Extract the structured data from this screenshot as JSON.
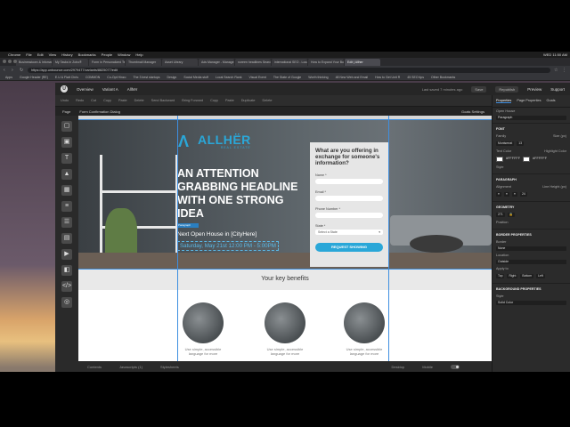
{
  "menubar": {
    "apple": "",
    "items": [
      "Chrome",
      "File",
      "Edit",
      "View",
      "History",
      "Bookmarks",
      "People",
      "Window",
      "Help"
    ],
    "right_status": "WED 11:50 AM"
  },
  "browser": {
    "tabs": [
      "Businesstown & Infomation",
      "My Tasks in Zoho®",
      "Form in Personalized Template",
      "Thumbnail Manager",
      "Asset Library",
      "Ads Manager - Manage",
      "noreen headlines Search",
      "international SEO - Localized",
      "How to Expand Your Business",
      "Edit | Allher"
    ],
    "active_tab_index": 9,
    "url": "https://app.unbounce.com/2979477/variants/8825077/edit",
    "bookmarks": [
      "Apps",
      "Google Header (RE)",
      "E.U & Flatt Chris",
      "COMMON",
      "Co-Opt Hinzo",
      "The 3 best startups",
      "Design",
      "Social Media stuff",
      "Local Search Rank",
      "Visual Event",
      "The State of Google",
      "Worth thinking",
      "48 New Web and Email",
      "How to Get Unit R",
      "45 SEO tips",
      "Other Bookmarks"
    ]
  },
  "app_header": {
    "overview": "Overview",
    "variant": "Variant A",
    "page_name": "Allhër",
    "last_saved": "Last saved 7 minutes ago",
    "save": "Save",
    "publish": "Republish",
    "preview": "Preview",
    "support": "Support"
  },
  "toolbar": {
    "items": [
      "Undo",
      "Redo",
      "Cut",
      "Copy",
      "Paste",
      "Delete",
      "Send Backward",
      "Bring Forward",
      "Copy",
      "Paste",
      "Duplicate",
      "Delete"
    ]
  },
  "subtoolbar": {
    "page": "Page",
    "form_confirmation": "Form Confirmation Dialog",
    "goals": "Goals Settings"
  },
  "rail_icons": [
    "box-icon",
    "box-icon",
    "text-icon",
    "image-icon",
    "image-icon",
    "form-icon",
    "list-icon",
    "list-icon",
    "video-icon",
    "video-icon",
    "code-icon",
    "social-icon"
  ],
  "hero": {
    "brand_mark": "Λ",
    "brand_name": "ALLHËR",
    "brand_sub": "REAL ESTATE",
    "headline": "AN ATTENTION GRABBING HEADLINE WITH ONE STRONG IDEA",
    "event": "Next Open House in [CityHere]",
    "event_date": "Saturday, May 21st 12:00 PM - 5:00PM",
    "selection_tag": "Paragraph"
  },
  "form": {
    "question": "What are you offering in exchange for someone's information?",
    "name_label": "Name *",
    "email_label": "Email *",
    "phone_label": "Phone Number *",
    "state_label": "State *",
    "state_value": "Select a State",
    "submit": "REQUEST SHOWING"
  },
  "benefits": {
    "title": "Your key benefits",
    "items": [
      {
        "text": "Use simple, accessible language for more"
      },
      {
        "text": "Use simple, accessible language for more"
      },
      {
        "text": "Use simple, accessible language for more"
      }
    ]
  },
  "bottom": {
    "contents": "Contents",
    "javascripts": "Javascripts (1)",
    "stylesheets": "Stylesheets",
    "desktop": "Desktop",
    "mobile": "Mobile"
  },
  "panel": {
    "tabs": [
      "Properties",
      "Page Properties",
      "Goals"
    ],
    "element": "Open House",
    "element_type": "Paragraph",
    "font_section": "FONT",
    "family_label": "Family",
    "family_value": "Montserrat",
    "size_label": "Size (px)",
    "size_value": "13",
    "text_color_label": "Text Color",
    "text_color": "#FFFFFF",
    "highlight_label": "Highlight Color",
    "highlight_color": "#FFFFFF",
    "style_label": "Style",
    "paragraph_section": "PARAGRAPH",
    "alignment_label": "Alignment",
    "line_height_label": "Line Height (px)",
    "line_height": "24",
    "geometry_section": "GEOMETRY",
    "size_w": "271",
    "position_label": "Position",
    "border_section": "BORDER PROPERTIES",
    "border_label": "Border",
    "border_value": "None",
    "location_label": "Location",
    "location_value": "Outside",
    "apply_to_label": "Apply to",
    "apply_to": [
      "Top",
      "Right",
      "Bottom",
      "Left"
    ],
    "background_section": "BACKGROUND PROPERTIES",
    "bg_style_label": "Style",
    "bg_style_value": "Solid Color"
  }
}
